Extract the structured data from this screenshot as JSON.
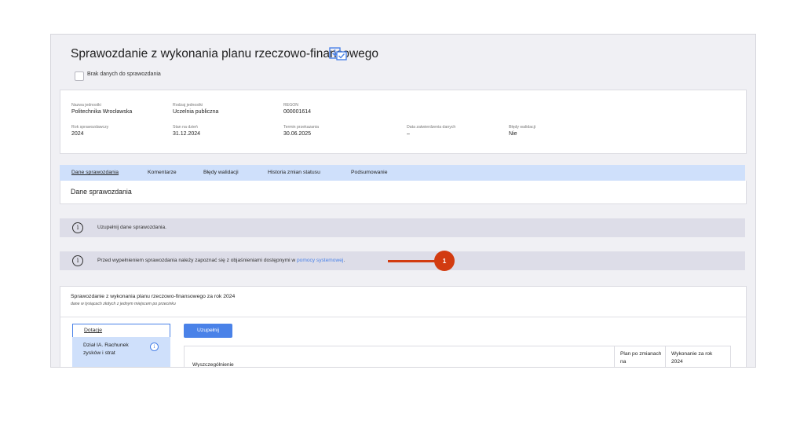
{
  "header": {
    "title": "Sprawozdanie z wykonania planu rzeczowo-finansowego",
    "title_icon": "download-check-icon",
    "no_data_label": "Brak danych do sprawozdania"
  },
  "info_card": {
    "nazwa_label": "Nazwa jednostki",
    "nazwa_value": "Politechnika Wrocławska",
    "rodzaj_label": "Rodzaj jednostki",
    "rodzaj_value": "Uczelnia publiczna",
    "regon_label": "REGON",
    "regon_value": "000001614",
    "rok_label": "Rok sprawozdawczy",
    "rok_value": "2024",
    "stan_label": "Stan na dzień",
    "stan_value": "31.12.2024",
    "termin_label": "Termin przekazania",
    "termin_value": "30.06.2025",
    "zatw_label": "Data zatwierdzenia danych",
    "zatw_value": "–",
    "bledy_label": "Błędy walidacji",
    "bledy_value": "Nie"
  },
  "tabs": [
    {
      "label": "Dane sprawozdania"
    },
    {
      "label": "Komentarze"
    },
    {
      "label": "Błędy walidacji"
    },
    {
      "label": "Historia zmian statusu"
    },
    {
      "label": "Podsumowanie"
    }
  ],
  "tab_panel_title": "Dane sprawozdania",
  "info_1": {
    "text": "Uzupełnij dane sprawozdania."
  },
  "info_2": {
    "text_before": "Przed wypełnieniem sprawozdania należy zapoznać się z objaśnieniami dostępnymi w ",
    "link": "pomocy systemowej",
    "text_after": "."
  },
  "annotation_marker": "1",
  "report": {
    "title": "Sprawozdanie z wykonania planu rzeczowo-finansowego za rok 2024",
    "subtitle": "dane w tysiącach złotych z jednym miejscem po przecinku",
    "side_nav": {
      "dotacje": "Dotacje",
      "item_1": "Dział IA. Rachunek zysków i strat"
    },
    "fill_button": "Uzupełnij",
    "table_headers": {
      "col1": "Wyszczególnienie",
      "col2": "Plan po zmianach na",
      "col3": "Wykonanie za rok 2024"
    }
  },
  "colors": {
    "accent": "#4a82e8",
    "tab_bg": "#cfe0fb",
    "marker": "#d23b10",
    "info_bg": "#dddde8"
  }
}
